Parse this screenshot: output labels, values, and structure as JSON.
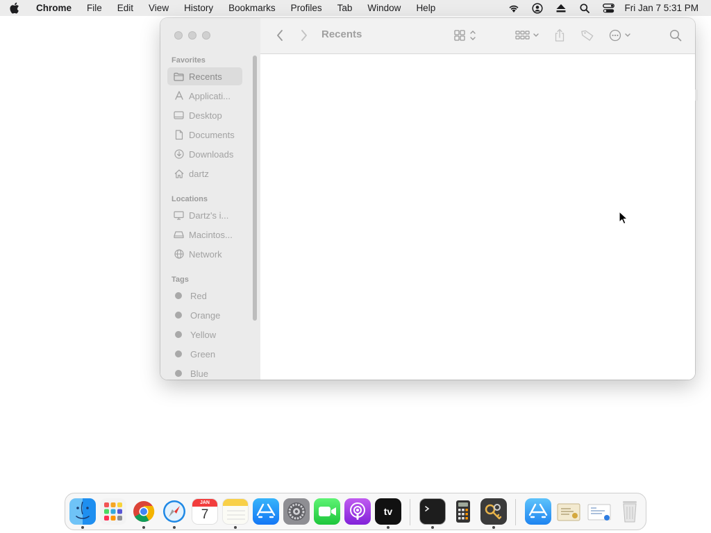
{
  "menubar": {
    "apple_icon": "apple-logo",
    "app_name": "Chrome",
    "items": [
      "File",
      "Edit",
      "View",
      "History",
      "Bookmarks",
      "Profiles",
      "Tab",
      "Window",
      "Help"
    ],
    "status_icons": [
      "wifi-icon",
      "user-account-icon",
      "eject-icon",
      "search-icon",
      "control-center-icon"
    ],
    "clock": "Fri Jan 7  5:31 PM"
  },
  "finder": {
    "title": "Recents",
    "sidebar": {
      "favorites_heading": "Favorites",
      "favorites": [
        {
          "label": "Recents",
          "icon": "recents-folder-icon",
          "selected": true
        },
        {
          "label": "Applicati...",
          "icon": "applications-icon"
        },
        {
          "label": "Desktop",
          "icon": "desktop-icon"
        },
        {
          "label": "Documents",
          "icon": "document-icon"
        },
        {
          "label": "Downloads",
          "icon": "download-icon"
        },
        {
          "label": "dartz",
          "icon": "home-icon"
        }
      ],
      "locations_heading": "Locations",
      "locations": [
        {
          "label": "Dartz's i...",
          "icon": "computer-icon"
        },
        {
          "label": "Macintos...",
          "icon": "disk-icon"
        },
        {
          "label": "Network",
          "icon": "network-icon"
        }
      ],
      "tags_heading": "Tags",
      "tags": [
        {
          "label": "Red"
        },
        {
          "label": "Orange"
        },
        {
          "label": "Yellow"
        },
        {
          "label": "Green"
        },
        {
          "label": "Blue"
        }
      ]
    }
  },
  "dock": {
    "apps": [
      {
        "name": "Finder",
        "icon": "finder-icon",
        "running": true
      },
      {
        "name": "Launchpad",
        "icon": "launchpad-icon",
        "running": false
      },
      {
        "name": "Google Chrome",
        "icon": "chrome-icon",
        "running": true
      },
      {
        "name": "Safari",
        "icon": "safari-icon",
        "running": true
      },
      {
        "name": "Calendar",
        "icon": "calendar-icon",
        "running": false,
        "month": "JAN",
        "day": "7"
      },
      {
        "name": "Notes",
        "icon": "notes-icon",
        "running": true
      },
      {
        "name": "App Store",
        "icon": "app-store-icon",
        "running": false
      },
      {
        "name": "System Settings",
        "icon": "settings-gear-icon",
        "running": false
      },
      {
        "name": "FaceTime",
        "icon": "facetime-icon",
        "running": false
      },
      {
        "name": "Podcasts",
        "icon": "podcasts-icon",
        "running": false
      },
      {
        "name": "Apple TV",
        "icon": "apple-tv-icon",
        "running": true,
        "label": "tv"
      },
      {
        "name": "Terminal",
        "icon": "terminal-icon",
        "running": true
      },
      {
        "name": "Calculator",
        "icon": "calculator-icon",
        "running": false
      },
      {
        "name": "Keychain Access",
        "icon": "keychain-icon",
        "running": true
      },
      {
        "name": "Applications",
        "icon": "applications-stack-icon",
        "running": false
      },
      {
        "name": "Certificate",
        "icon": "certificate-icon",
        "running": false
      },
      {
        "name": "Document Stack",
        "icon": "document-stack-icon",
        "running": false
      },
      {
        "name": "Trash",
        "icon": "trash-icon",
        "running": false
      }
    ]
  },
  "colors": {
    "menubar_bg": "#ececec",
    "sidebar_bg": "#ebebeb",
    "selected_bg": "#dcdcdc",
    "text_dim": "#a2a2a2"
  }
}
